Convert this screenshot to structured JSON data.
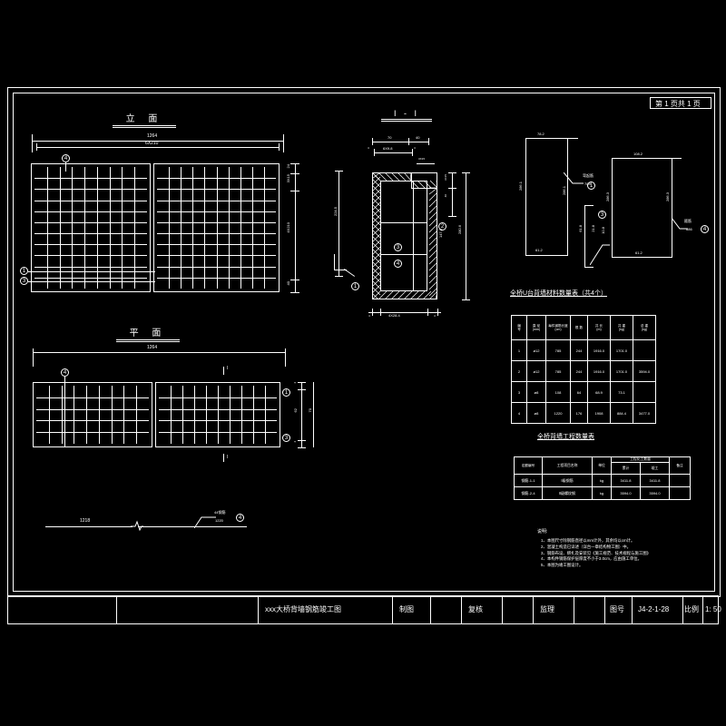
{
  "drawing": {
    "background": "#000000",
    "line_color": "#ffffff",
    "page_indicator": "第 1 页共 1 页"
  },
  "views": {
    "elevation": {
      "title": "立    面",
      "dim_overall_top": "1264",
      "dim_inner_top": "6X210",
      "dim_right_top": "24",
      "dim_right_mid": "3X15",
      "dim_right_main": "4X210",
      "dim_right_bottom": "40",
      "bubble_top": "4",
      "bubble_left_1": "1",
      "bubble_left_2": "3"
    },
    "section": {
      "title": "I - I",
      "dim_top_left": "70",
      "dim_top_right": "40",
      "dim_inner": "6X9.8",
      "dim_small_right": "3X15",
      "dim_edge_a": "4",
      "dim_edge_b": "4",
      "dim_right_15": "3X15",
      "dim_right_40": "40",
      "dim_right_147": "147.8",
      "dim_right_280": "280.6",
      "dim_left_224": "224.5",
      "dim_bottom_left": "4",
      "dim_bottom_mid": "4X28.4",
      "dim_bottom_right": "4",
      "bubble_1": "1",
      "bubble_2": "2",
      "bubble_3": "3",
      "bubble_4": "4"
    },
    "plan": {
      "title": "平    面",
      "dim_top": "1264",
      "dim_right_top": "4",
      "dim_right_mid": "62",
      "dim_right_all": "70",
      "dim_right_bottom": "4",
      "bubble_top": "4",
      "bubble_right_1": "1",
      "bubble_right_2": "3",
      "section_mark_top": "I",
      "section_mark_bottom": "I"
    },
    "bar_details": {
      "bar1": {
        "dim_top": "78.2",
        "dim_right": "286.1",
        "dim_bottom": "61.2",
        "callout_text": "弯起筋",
        "callout_len": "785",
        "bubble": "1"
      },
      "bar3": {
        "dim_left": "61.8",
        "dim_mid": "21.8",
        "dim_right": "10.8",
        "bubble": "3"
      },
      "bar4": {
        "dim_top": "108.2",
        "dim_left": "286.3",
        "dim_right": "286.3",
        "dim_bottom": "61.2",
        "callout_text": "箍筋",
        "callout_len": "686",
        "bubble": "4"
      },
      "bar_straight": {
        "dim_len": "1218",
        "callout_text": "44钢筋",
        "callout_len": "1220",
        "bubble": "4"
      }
    }
  },
  "material_table": {
    "title": "全桥U台背墙材料数量表（共4个）",
    "headers": [
      [
        "编",
        "号"
      ],
      [
        "直  径",
        "(mm)"
      ],
      [
        "每件钢筋长度",
        "(cm)"
      ],
      [
        "根  数",
        ""
      ],
      [
        "共  长",
        "(m)"
      ],
      [
        "共  重",
        "(kg)"
      ],
      [
        "总  重",
        "(kg)"
      ]
    ],
    "rows": [
      {
        "no": "1",
        "dia": "⌀12",
        "len": "785",
        "count": "244",
        "total_len": "1916.0",
        "weight": "1701.0",
        "sum": ""
      },
      {
        "no": "2",
        "dia": "⌀12",
        "len": "785",
        "count": "244",
        "total_len": "1916.0",
        "weight": "1701.0",
        "sum": "3594.0"
      },
      {
        "no": "3",
        "dia": "⌀8",
        "len": "108",
        "count": "64",
        "total_len": "68.9",
        "weight": "73.1",
        "sum": ""
      },
      {
        "no": "4",
        "dia": "⌀8",
        "len": "1220",
        "count": "176",
        "total_len": "1908",
        "weight": "884.4",
        "sum": "3477.0"
      }
    ]
  },
  "quantity_table": {
    "title": "全桥背墙工程数量表",
    "headers": {
      "code": "定额编号",
      "item": "工程项目名称",
      "unit": "单位",
      "qty_group": "工程化工数量",
      "qty_sub_1": "累计",
      "qty_sub_2": "竣工",
      "remark": "备注"
    },
    "rows": [
      {
        "code": "钢筋-1-1",
        "item": "Ⅰ级钢筋",
        "unit": "kg",
        "acc": "3411.8",
        "fin": "3411.8",
        "remark": ""
      },
      {
        "code": "钢筋-2-4",
        "item": "Ⅱ级螺纹钢",
        "unit": "kg",
        "acc": "3594.0",
        "fin": "3594.0",
        "remark": ""
      }
    ]
  },
  "notes": {
    "title": "说明:",
    "items": [
      "1、本图尺寸除钢筋直径以mm计外，其余均以cm计。",
      "2、混凝土构造已详述（详台一章结构物工图）中。",
      "3、钢筋布设、绑扎及安装见《施工规范、技术规程与施工图》",
      "4、本构件钢筋保护层厚度不小于3.0cm，应由施工单位。",
      "5、本图为竣工图设计。"
    ]
  },
  "title_block": {
    "drawing_name": "xxx大桥背墙钢筋竣工图",
    "col_draw": "制图",
    "col_draw_val": "",
    "col_check": "复核",
    "col_check_val": "",
    "col_supervise": "监理",
    "col_supervise_val": "",
    "label_no": "图号",
    "value_no": "J4-2-1-28",
    "label_scale": "比例",
    "value_scale": "1: 50"
  }
}
